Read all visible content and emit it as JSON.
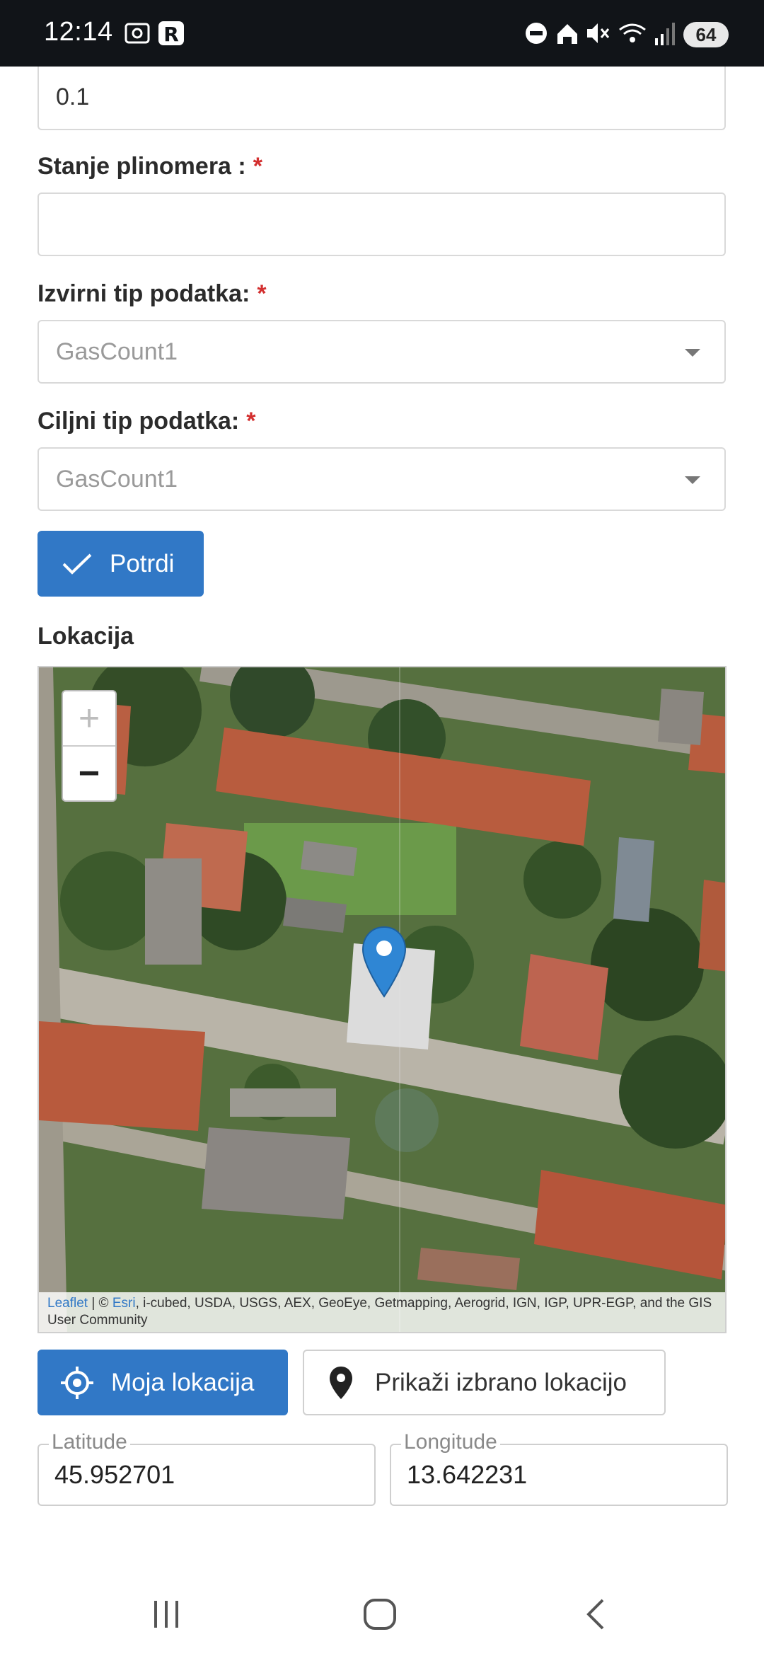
{
  "status_bar": {
    "time": "12:14",
    "battery": "64",
    "icons": [
      "screenshot-icon",
      "r-app-icon",
      "dnd-icon",
      "home-icon",
      "mute-icon",
      "wifi-icon",
      "signal-icon"
    ]
  },
  "form": {
    "top_value": "0.1",
    "meter_label": "Stanje plinomera :",
    "meter_value": "",
    "required_mark": "*",
    "source_label": "Izvirni tip podatka:",
    "source_value": "GasCount1",
    "target_label": "Ciljni tip podatka:",
    "target_value": "GasCount1",
    "confirm_label": "Potrdi"
  },
  "location": {
    "title": "Lokacija",
    "zoom_in": "+",
    "zoom_out": "−",
    "attribution_link1": "Leaflet",
    "attribution_sep": " | © ",
    "attribution_link2": "Esri",
    "attribution_text": ", i-cubed, USDA, USGS, AEX, GeoEye, Getmapping, Aerogrid, IGN, IGP, UPR-EGP, and the GIS User Community",
    "my_location_label": "Moja lokacija",
    "show_selected_label": "Prikaži izbrano lokacijo",
    "latitude_label": "Latitude",
    "latitude_value": "45.952701",
    "longitude_label": "Longitude",
    "longitude_value": "13.642231"
  },
  "colors": {
    "primary": "#3178c6",
    "required": "#d32f2f",
    "status_bar": "#111418"
  }
}
